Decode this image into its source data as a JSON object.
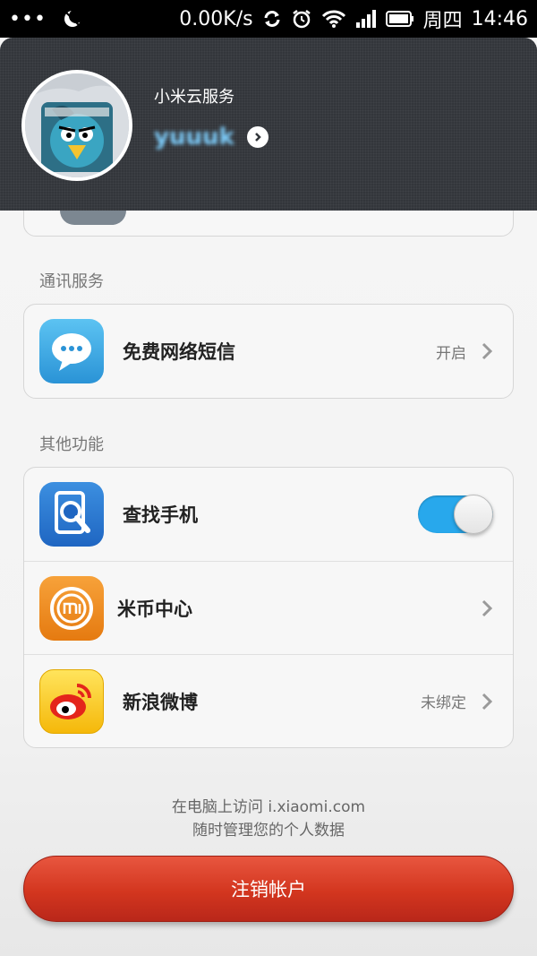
{
  "status_bar": {
    "network_speed": "0.00K/s",
    "weekday": "周四",
    "time": "14:46"
  },
  "header": {
    "title": "小米云服务",
    "username": "yuuuk"
  },
  "sections": [
    {
      "label": "通讯服务",
      "rows": [
        {
          "label": "免费网络短信",
          "value": "开启",
          "icon": "chat-bubble-icon"
        }
      ]
    },
    {
      "label": "其他功能",
      "rows": [
        {
          "label": "查找手机",
          "toggle_on": true,
          "icon": "find-phone-icon"
        },
        {
          "label": "米币中心",
          "value": "",
          "icon": "mi-coin-icon"
        },
        {
          "label": "新浪微博",
          "value": "未绑定",
          "icon": "weibo-icon"
        }
      ]
    }
  ],
  "footer": {
    "line1": "在电脑上访问 i.xiaomi.com",
    "line2": "随时管理您的个人数据"
  },
  "logout_button": "注销帐户",
  "colors": {
    "header_bg": "#33363b",
    "toggle_on": "#28a8ec",
    "logout_red": "#d3361f"
  }
}
